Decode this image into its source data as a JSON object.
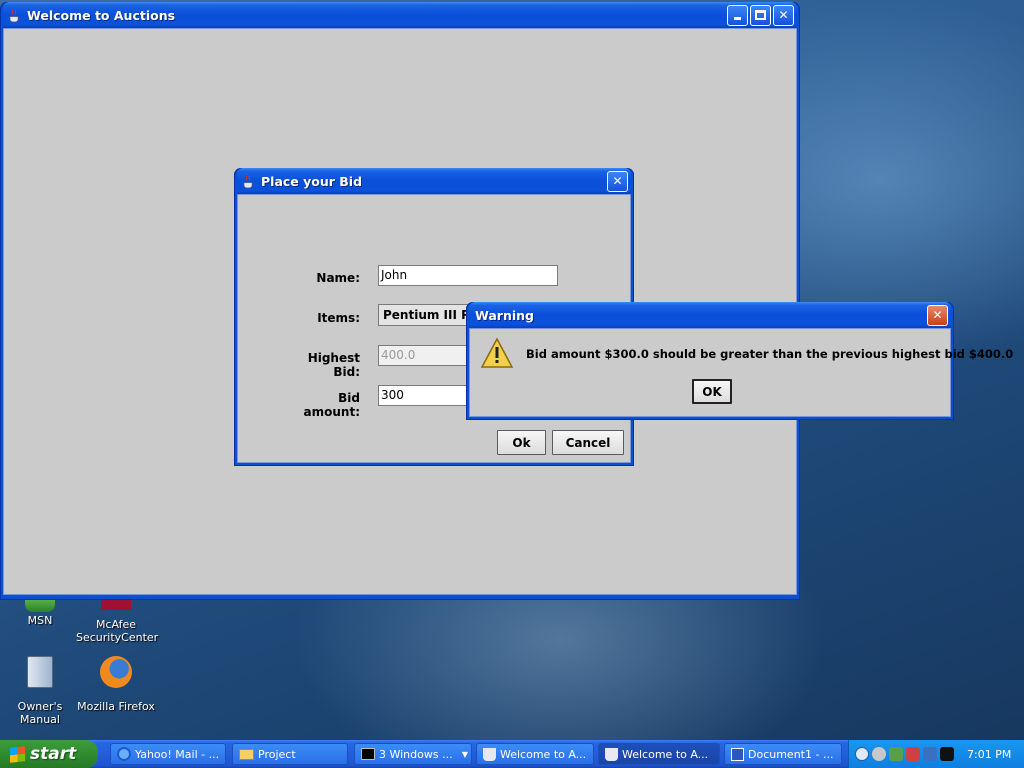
{
  "desktop": {
    "icons": [
      {
        "label": "MSN"
      },
      {
        "label": "McAfee SecurityCenter"
      },
      {
        "label": "Owner's Manual"
      },
      {
        "label": "Mozilla Firefox"
      }
    ]
  },
  "main_window": {
    "title": "Welcome to Auctions"
  },
  "bid_dialog": {
    "title": "Place your Bid",
    "name_label": "Name:",
    "name_value": "John",
    "items_label": "Items:",
    "items_value": "Pentium III Processor",
    "highest_bid_label": "Highest Bid:",
    "highest_bid_value": "400.0",
    "bid_amount_label": "Bid amount:",
    "bid_amount_value": "300",
    "ok_label": "Ok",
    "cancel_label": "Cancel"
  },
  "warning_dialog": {
    "title": "Warning",
    "message": "Bid amount $300.0 should be greater than the previous highest bid $400.0",
    "ok_label": "OK"
  },
  "taskbar": {
    "start_label": "start",
    "tasks": [
      {
        "label": "Yahoo! Mail - ..."
      },
      {
        "label": "Project"
      },
      {
        "label": "3 Windows ..."
      },
      {
        "label": "Welcome to A..."
      },
      {
        "label": "Welcome to A..."
      },
      {
        "label": "Document1 - ..."
      }
    ],
    "clock": "7:01 PM"
  }
}
